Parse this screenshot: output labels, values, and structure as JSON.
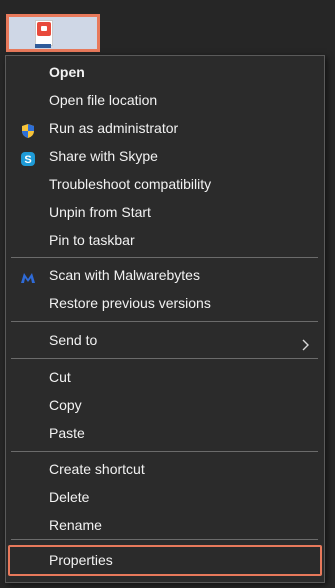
{
  "menu": {
    "group1": [
      {
        "label": "Open",
        "icon": ""
      },
      {
        "label": "Open file location",
        "icon": ""
      },
      {
        "label": "Run as administrator",
        "icon": "uac-shield-icon"
      },
      {
        "label": "Share with Skype",
        "icon": "skype-icon"
      },
      {
        "label": "Troubleshoot compatibility",
        "icon": ""
      },
      {
        "label": "Unpin from Start",
        "icon": ""
      },
      {
        "label": "Pin to taskbar",
        "icon": ""
      }
    ],
    "group2": [
      {
        "label": "Scan with Malwarebytes",
        "icon": "malwarebytes-icon"
      },
      {
        "label": "Restore previous versions",
        "icon": ""
      }
    ],
    "group3": [
      {
        "label": "Send to",
        "icon": "chevron-right-icon"
      }
    ],
    "group4": [
      {
        "label": "Cut"
      },
      {
        "label": "Copy"
      },
      {
        "label": "Paste"
      }
    ],
    "group5": [
      {
        "label": "Create shortcut"
      },
      {
        "label": "Delete"
      },
      {
        "label": "Rename"
      }
    ],
    "group6": [
      {
        "label": "Properties"
      }
    ]
  },
  "colors": {
    "menu_background": "#2b2b2b",
    "text": "#f2f2f2",
    "separator": "#6b6b6b",
    "highlight_outline": "#e8795b",
    "skype_blue": "#1e9bd7",
    "malwarebytes_blue": "#2f6bd8"
  }
}
